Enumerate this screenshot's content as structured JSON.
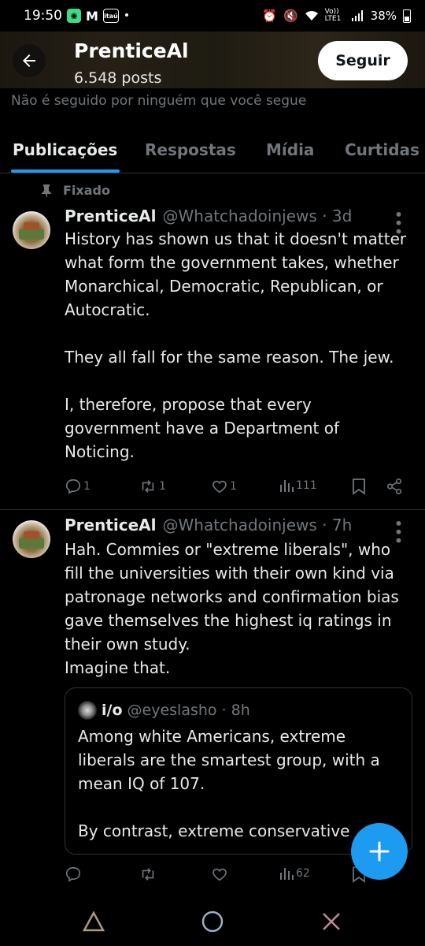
{
  "status_bar": {
    "time": "19:50",
    "app_icons": [
      "whatsapp-like-app-icon",
      "gmail-icon",
      "itau-icon"
    ],
    "gmail_glyph": "M",
    "itau_label": "itaú",
    "dot": "•",
    "network_label": "Vo)) LTE1",
    "battery": "38%"
  },
  "header": {
    "title": "PrenticeAl",
    "posts_count": "6.548 posts",
    "follow_label": "Seguir"
  },
  "followed_by": "Não é seguido por ninguém que você segue",
  "tabs": [
    {
      "label": "Publicações",
      "active": true
    },
    {
      "label": "Respostas",
      "active": false
    },
    {
      "label": "Mídia",
      "active": false
    },
    {
      "label": "Curtidas",
      "active": false
    }
  ],
  "posts": [
    {
      "pinned_label": "Fixado",
      "name": "PrenticeAl",
      "handle": "@Whatchadoinjews · 3d",
      "body": "History has shown us that it doesn't matter what form the government takes, whether Monarchical, Democratic, Republican, or Autocratic.\n\nThey all fall for the same reason. The jew.\n\nI, therefore, propose that every government have a Department of Noticing.",
      "replies": "1",
      "reposts": "1",
      "likes": "1",
      "views": "111"
    },
    {
      "name": "PrenticeAl",
      "handle": "@Whatchadoinjews · 7h",
      "body": "Hah. Commies or \"extreme liberals\", who fill the universities with their own kind via patronage networks and confirmation bias gave themselves the highest iq ratings in their own study.\nImagine that.",
      "quote": {
        "name": "i/o",
        "handle": "@eyeslasho · 8h",
        "body": "Among white Americans, extreme liberals are the smartest group, with a mean IQ of 107.\n\nBy contrast, extreme conservative"
      },
      "replies": "",
      "reposts": "",
      "likes": "",
      "views": "62"
    }
  ],
  "colors": {
    "accent": "#1d9bf0",
    "muted": "#71767b",
    "border": "#2f3336",
    "text": "#e7e9ea"
  }
}
